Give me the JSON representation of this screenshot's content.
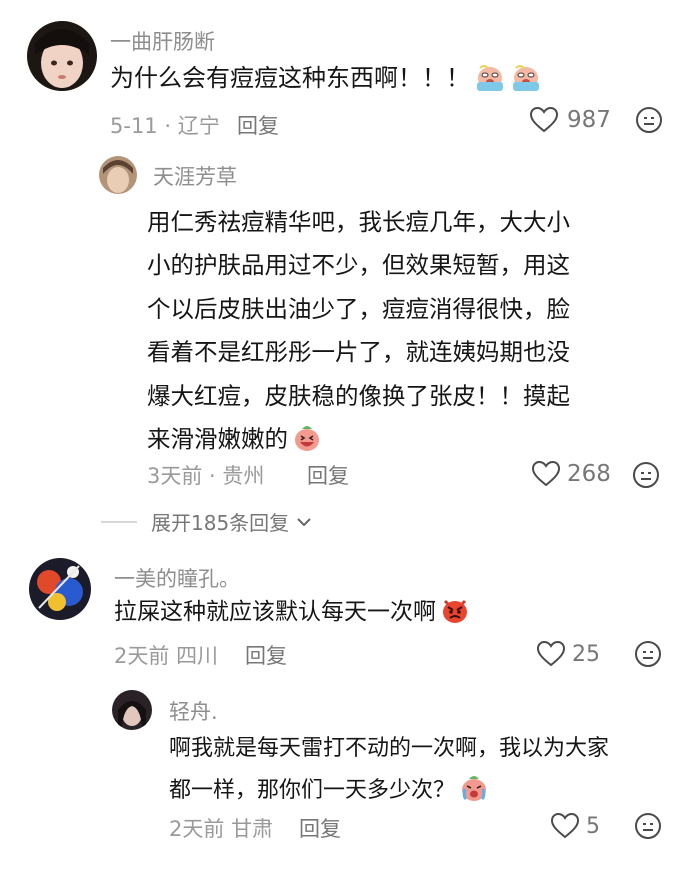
{
  "comments": [
    {
      "username": "一曲肝肠断",
      "text": "为什么会有痘痘这种东西啊！！！",
      "date": "5-11",
      "location": "辽宁",
      "reply_label": "回复",
      "likes": "987",
      "emojis": [
        "crying-face-emoji",
        "crying-face-emoji"
      ]
    },
    {
      "username": "天涯芳草",
      "lines": [
        "用仁秀祛痘精华吧，我长痘几年，大大小",
        "小的护肤品用过不少，但效果短暂，用这",
        "个以后皮肤出油少了，痘痘消得很快，脸",
        "看着不是红彤彤一片了，就连姨妈期也没",
        "爆大红痘，皮肤稳的像换了张皮！！摸起",
        "来滑滑嫩嫩的"
      ],
      "date": "3天前",
      "location": "贵州",
      "reply_label": "回复",
      "likes": "268",
      "emojis": [
        "grinning-face-emoji"
      ]
    },
    {
      "username": "一美的瞳孔。",
      "text": "拉屎这种就应该默认每天一次啊",
      "date": "2天前",
      "location": "四川",
      "reply_label": "回复",
      "likes": "25",
      "emojis": [
        "angry-face-emoji"
      ]
    },
    {
      "username": "轻舟.",
      "lines": [
        "啊我就是每天雷打不动的一次啊，我以为大家",
        "都一样，那你们一天多少次？"
      ],
      "date": "2天前",
      "location": "甘肃",
      "reply_label": "回复",
      "likes": "5",
      "emojis": [
        "crying-face-emoji"
      ]
    }
  ],
  "expand_replies_label": "展开185条回复",
  "icons": {
    "like": "heart-outline-icon",
    "dislike": "meh-face-icon",
    "expand": "chevron-down-icon"
  }
}
